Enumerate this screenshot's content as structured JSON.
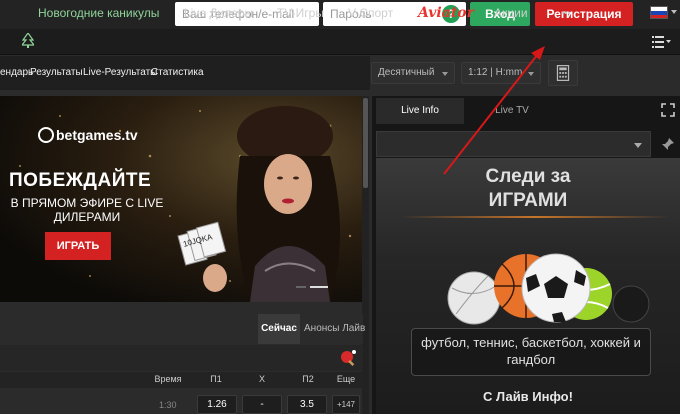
{
  "header": {
    "phone_placeholder": "Ваш телефон/e-mail",
    "password_placeholder": "Пароль",
    "help_icon": "?",
    "login_label": "Вход",
    "register_label": "Регистрация",
    "colors": {
      "login": "#2ea85e",
      "register": "#d42222"
    }
  },
  "nav": {
    "items": [
      "Новогодние каникулы",
      "Live Дилеры",
      "TV-Игры",
      "V-Спорт",
      "Aviator",
      "Акции",
      "•••"
    ]
  },
  "subnav": {
    "links": [
      "ендарь",
      "Результаты",
      "Live-Результаты",
      "Статистика"
    ],
    "odds_format": "Десятичный",
    "time_format": "1:12 | H:mm"
  },
  "banner": {
    "logo": "betgames.tv",
    "headline": "ПОБЕЖДАЙТЕ",
    "subline": "В ПРЯМОМ ЭФИРЕ С LIVE ДИЛЕРАМИ",
    "cta": "ИГРАТЬ",
    "cards": "10JQKA"
  },
  "tabs": {
    "active": "Сейчас",
    "other": "Анонсы Лайв"
  },
  "table": {
    "headers": [
      "Время",
      "П1",
      "X",
      "П2",
      "Еще"
    ],
    "row": {
      "time": "1:30",
      "p1": "1.26",
      "x": "-",
      "p2": "3.5",
      "more": "+147"
    }
  },
  "right": {
    "tab_live_info": "Live Info",
    "tab_live_tv": "Live TV",
    "promo_title_1": "Следи за",
    "promo_title_2": "ИГРАМИ",
    "promo_text": "футбол, теннис, баскетбол, хоккей и гандбол",
    "promo_footer": "С Лайв Инфо!"
  }
}
